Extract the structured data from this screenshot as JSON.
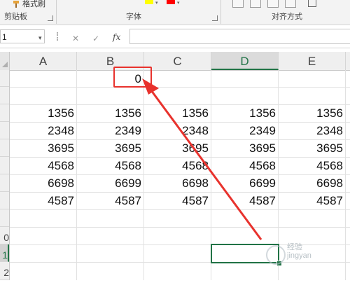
{
  "ribbon": {
    "format_painter_label": "格式刷",
    "groups": {
      "clipboard": "剪贴板",
      "font": "字体",
      "alignment": "对齐方式"
    },
    "font_color": "#ff0000",
    "highlight_color": "#ffff00"
  },
  "formula_bar": {
    "name_box": "1",
    "fx_label": "fx",
    "formula": ""
  },
  "grid": {
    "columns": [
      "A",
      "B",
      "C",
      "D",
      "E"
    ],
    "selected_column": "D",
    "row_labels": [
      "0",
      "1",
      "2"
    ],
    "selected_row": "1",
    "b_header_value": "0",
    "rows": [
      [
        "1356",
        "1356",
        "1356",
        "1356",
        "1356"
      ],
      [
        "2348",
        "2349",
        "2348",
        "2349",
        "2348"
      ],
      [
        "3695",
        "3695",
        "3695",
        "3695",
        "3695"
      ],
      [
        "4568",
        "4568",
        "4568",
        "4568",
        "4568"
      ],
      [
        "6698",
        "6699",
        "6698",
        "6699",
        "6698"
      ],
      [
        "4587",
        "4587",
        "4587",
        "4587",
        "4587"
      ]
    ]
  },
  "annotation": {
    "color": "#e8322d"
  },
  "watermark": {
    "line1": "经验",
    "line2": "jingyan"
  }
}
